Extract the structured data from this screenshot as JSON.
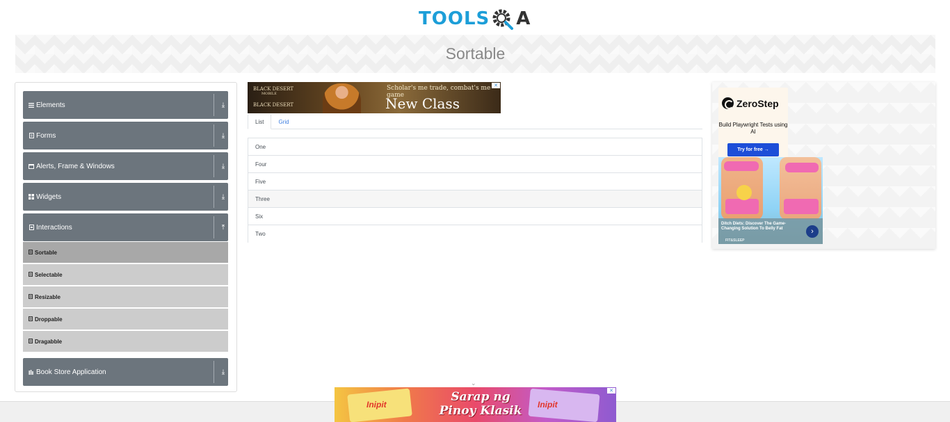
{
  "header": {
    "logo_text": "TOOLS",
    "logo_suffix": "A",
    "logo_icon": "gear-search-icon"
  },
  "banner": {
    "title": "Sortable"
  },
  "sidebar": {
    "groups": [
      {
        "label": "Elements",
        "icon": "hamburger-icon",
        "arrow": "⤓"
      },
      {
        "label": "Forms",
        "icon": "document-icon",
        "arrow": "⤓"
      },
      {
        "label": "Alerts, Frame & Windows",
        "icon": "window-icon",
        "arrow": "⤓"
      },
      {
        "label": "Widgets",
        "icon": "grid-icon",
        "arrow": "⤓"
      },
      {
        "label": "Interactions",
        "icon": "interactions-icon",
        "arrow": "⤒"
      },
      {
        "label": "Book Store Application",
        "icon": "book-icon",
        "arrow": "⤓"
      }
    ],
    "sub_items": [
      {
        "label": "Sortable",
        "active": true
      },
      {
        "label": "Selectable",
        "active": false
      },
      {
        "label": "Resizable",
        "active": false
      },
      {
        "label": "Droppable",
        "active": false
      },
      {
        "label": "Dragabble",
        "active": false
      }
    ]
  },
  "tabs": [
    {
      "label": "List",
      "active": true
    },
    {
      "label": "Grid",
      "active": false
    }
  ],
  "list_items": [
    "One",
    "Four",
    "Five",
    "Three",
    "Six",
    "Two"
  ],
  "ads": {
    "top": {
      "brand": "BLACK DESERT",
      "brand_sub": "MOBILE",
      "brand_bottom": "BLACK DESERT",
      "tagline": "Scholar's me trade, combat's me game",
      "headline": "New Class Scholar",
      "close": "✕"
    },
    "zerostep": {
      "name": "ZeroStep",
      "text": "Build Playwright Tests using AI",
      "button": "Try for free →"
    },
    "diet": {
      "caption": "Ditch Diets: Discover The Game-Changing Solution To Belly Fat",
      "source": "FIT&SLEEP",
      "go": "›"
    },
    "bottom": {
      "brand": "Inipit",
      "slogan": "Sarap ng Pinoy Klasik",
      "close": "✕"
    }
  },
  "colors": {
    "accent": "#1c9ed8",
    "group_bg": "#6c757d",
    "sub_bg": "#cccccc",
    "sub_active_bg": "#a8a8a8"
  }
}
